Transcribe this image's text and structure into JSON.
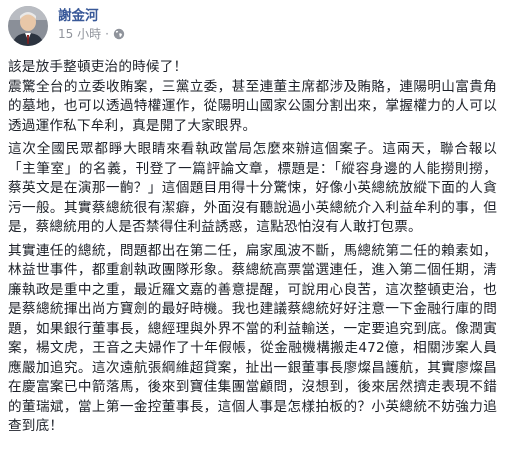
{
  "author": {
    "name": "謝金河"
  },
  "post_meta": {
    "timestamp": "15 小時",
    "separator": "·",
    "privacy_icon": "globe-icon"
  },
  "post_body": {
    "headline": "該是放手整頓吏治的時候了！",
    "paragraphs": [
      "震驚全台的立委收賄案，三黨立委，甚至連董主席都涉及賄賂，連陽明山富貴角的墓地，也可以透過特權運作，從陽明山國家公園分割出來，掌握權力的人可以透過運作私下牟利，真是開了大家眼界。",
      "這次全國民眾都睜大眼睛來看執政當局怎麼來辦這個案子。這兩天，聯合報以「主筆室」的名義，刊登了一篇評論文章，標題是：「縱容身邊的人能撈則撈，蔡英文是在演那一齣？」這個題目用得十分驚悚，好像小英總統放縱下面的人貪污一般。其實蔡總統很有潔癖，外面沒有聽說過小英總統介入利益牟利的事，但是，蔡總統用的人是否禁得住利益誘惑，這點恐怕沒有人敢打包票。",
      "其實連任的總統，問題都出在第二任，扁家風波不斷，馬總統第二任的賴素如，林益世事件，都重創執政團隊形象。蔡總統高票當選連任，進入第二個任期，清廉執政是重中之重，最近羅文嘉的善意提醒，可說用心良苦，這次整頓吏治，也是蔡總統揮出尚方寶劍的最好時機。我也建議蔡總統好好注意一下金融行庫的問題，如果銀行董事長，總經理與外界不當的利益輸送，一定要追究到底。像潤寅案，楊文虎，王音之夫婦作了十年假帳，從金融機構搬走472億，相關涉案人員應嚴加追究。這次遠航張綱維超貸案，扯出一銀董事長廖燦昌護航，其實廖燦昌在慶富案已中箭落馬，後來到寶佳集團當顧問，沒想到，後來居然擠走表現不錯的董瑞斌，當上第一金控董事長，這個人事是怎樣拍板的？小英總統不妨強力追查到底！"
    ]
  },
  "colors": {
    "author_link": "#385898",
    "body_text": "#1d2129",
    "meta_text": "#90949c"
  }
}
